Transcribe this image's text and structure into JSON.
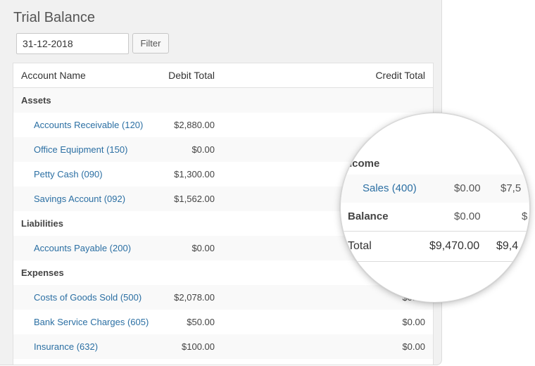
{
  "page": {
    "title": "Trial Balance",
    "date_value": "31-12-2018",
    "filter_label": "Filter"
  },
  "table": {
    "headers": {
      "account_name": "Account Name",
      "debit_total": "Debit Total",
      "credit_total": "Credit Total"
    },
    "groups": [
      {
        "label": "Assets",
        "rows": [
          {
            "name": "Accounts Receivable (120)",
            "debit": "$2,880.00",
            "credit": ""
          },
          {
            "name": "Office Equipment (150)",
            "debit": "$0.00",
            "credit": ""
          },
          {
            "name": "Petty Cash (090)",
            "debit": "$1,300.00",
            "credit": ""
          },
          {
            "name": "Savings Account (092)",
            "debit": "$1,562.00",
            "credit": ""
          }
        ]
      },
      {
        "label": "Liabilities",
        "rows": [
          {
            "name": "Accounts Payable (200)",
            "debit": "$0.00",
            "credit": ""
          }
        ]
      },
      {
        "label": "Expenses",
        "rows": [
          {
            "name": "Costs of Goods Sold (500)",
            "debit": "$2,078.00",
            "credit": "$0.00"
          },
          {
            "name": "Bank Service Charges (605)",
            "debit": "$50.00",
            "credit": "$0.00"
          },
          {
            "name": "Insurance (632)",
            "debit": "$100.00",
            "credit": "$0.00"
          }
        ]
      }
    ]
  },
  "magnifier": {
    "income_label": "ncome",
    "sales_name": "Sales (400)",
    "sales_debit": "$0.00",
    "sales_credit": "$7,5",
    "balance_label": "Balance",
    "balance_debit": "$0.00",
    "balance_credit": "$",
    "total_label": "Total",
    "total_debit": "$9,470.00",
    "total_credit": "$9,4"
  },
  "colors": {
    "link": "#2b6fa3",
    "panel_bg": "#f1f1f1"
  }
}
